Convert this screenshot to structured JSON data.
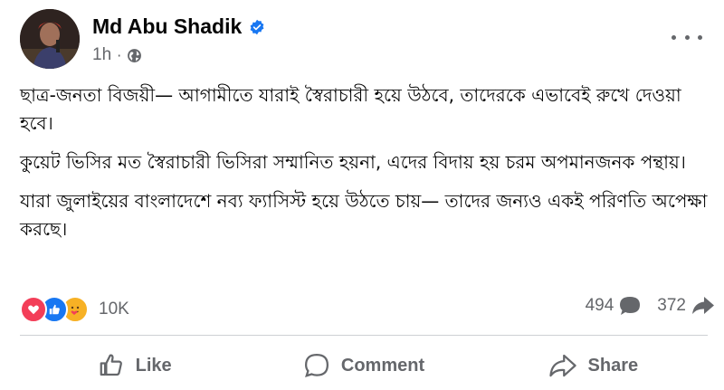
{
  "post": {
    "author": "Md Abu Shadik",
    "time": "1h",
    "dot": "·",
    "icons": {
      "verified": "verified-badge-icon",
      "audience": "globe-icon",
      "more": "more-options-icon"
    },
    "paragraphs": [
      "ছাত্র-জনতা বিজয়ী— আগামীতে যারাই স্বৈরাচারী হয়ে উঠবে, তাদেরকে এভাবেই রুখে দেওয়া হবে।",
      "কুয়েট ভিসির মত স্বৈরাচারী ভিসিরা সম্মানিত হয়না, এদের বিদায় হয় চরম অপমানজনক পন্থায়।",
      "যারা জুলাইয়ের বাংলাদেশে নব্য ফ্যাসিস্ট হয়ে উঠতে চায়— তাদের জন্যও একই পরিণতি অপেক্ষা করছে।"
    ]
  },
  "stats": {
    "reaction_icons": [
      "love-reaction-icon",
      "like-reaction-icon",
      "care-reaction-icon"
    ],
    "reaction_count": "10K",
    "comments": "494",
    "shares": "372"
  },
  "actions": {
    "like": "Like",
    "comment": "Comment",
    "share": "Share"
  },
  "colors": {
    "verified": "#1877f2",
    "secondary_text": "#65676b",
    "love": "#f33e58",
    "like": "#1877f2",
    "care": "#f7b125"
  }
}
